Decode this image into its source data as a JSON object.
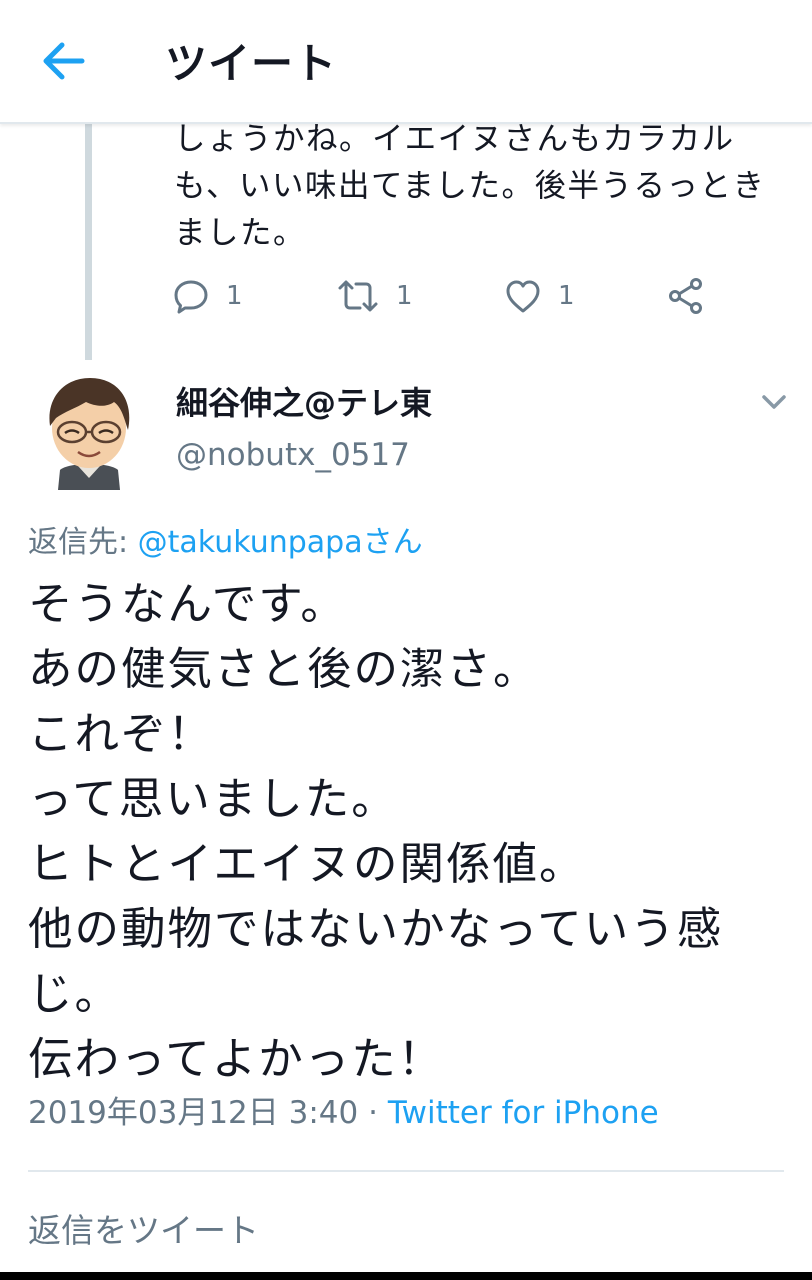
{
  "header": {
    "title": "ツイート",
    "back_icon": "arrow-left-icon"
  },
  "previous_tweet": {
    "text_lines": [
      "しょうかね。イエイヌさんもカラカル",
      "も、いい味出てました。後半うるっとき",
      "ました。"
    ],
    "actions": {
      "reply_count": "1",
      "retweet_count": "1",
      "like_count": "1"
    }
  },
  "tweet": {
    "author_name": "細谷伸之@テレ東",
    "author_handle": "@nobutx_0517",
    "reply_to_prefix": "返信先: ",
    "reply_to_user": "@takukunpapaさん",
    "body_lines": [
      "そうなんです。",
      "あの健気さと後の潔さ。",
      "これぞ！",
      "って思いました。",
      "ヒトとイエイヌの関係値。",
      "他の動物ではないかなっていう感",
      "じ。",
      "伝わってよかった！"
    ],
    "timestamp": "2019年03月12日 3:40",
    "separator": " · ",
    "source": "Twitter for iPhone"
  },
  "reply_input": {
    "placeholder": "返信をツイート"
  },
  "colors": {
    "accent": "#1da1f2",
    "secondary_text": "#657786",
    "text": "#141823",
    "divider": "#e1e8ed"
  }
}
